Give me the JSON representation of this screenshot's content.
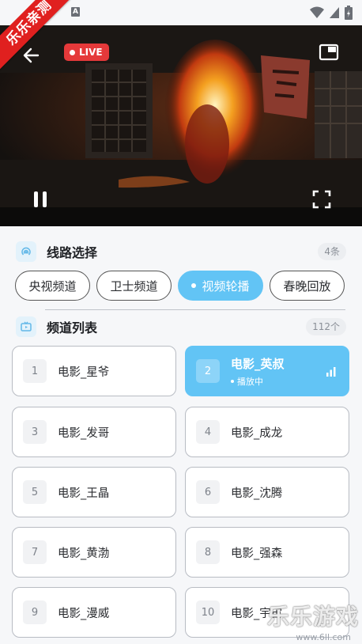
{
  "watermark": {
    "corner_badge": "乐乐亲测",
    "brand": "乐乐游戏",
    "url": "www.6ll.com"
  },
  "player": {
    "live_label": "LIVE"
  },
  "routes": {
    "title": "线路选择",
    "count": "4条",
    "items": [
      {
        "label": "央视频道",
        "active": false
      },
      {
        "label": "卫士频道",
        "active": false
      },
      {
        "label": "视频轮播",
        "active": true
      },
      {
        "label": "春晚回放",
        "active": false
      }
    ]
  },
  "channels": {
    "title": "频道列表",
    "count": "112个",
    "playing_label": "播放中",
    "items": [
      {
        "num": "1",
        "name": "电影_星爷"
      },
      {
        "num": "2",
        "name": "电影_英叔",
        "active": true
      },
      {
        "num": "3",
        "name": "电影_发哥"
      },
      {
        "num": "4",
        "name": "电影_成龙"
      },
      {
        "num": "5",
        "name": "电影_王晶"
      },
      {
        "num": "6",
        "name": "电影_沈腾"
      },
      {
        "num": "7",
        "name": "电影_黄渤"
      },
      {
        "num": "8",
        "name": "电影_强森"
      },
      {
        "num": "9",
        "name": "电影_漫威"
      },
      {
        "num": "10",
        "name": "电影_宇宙"
      }
    ]
  },
  "colors": {
    "accent": "#62c4f5",
    "live": "#e5393a"
  }
}
